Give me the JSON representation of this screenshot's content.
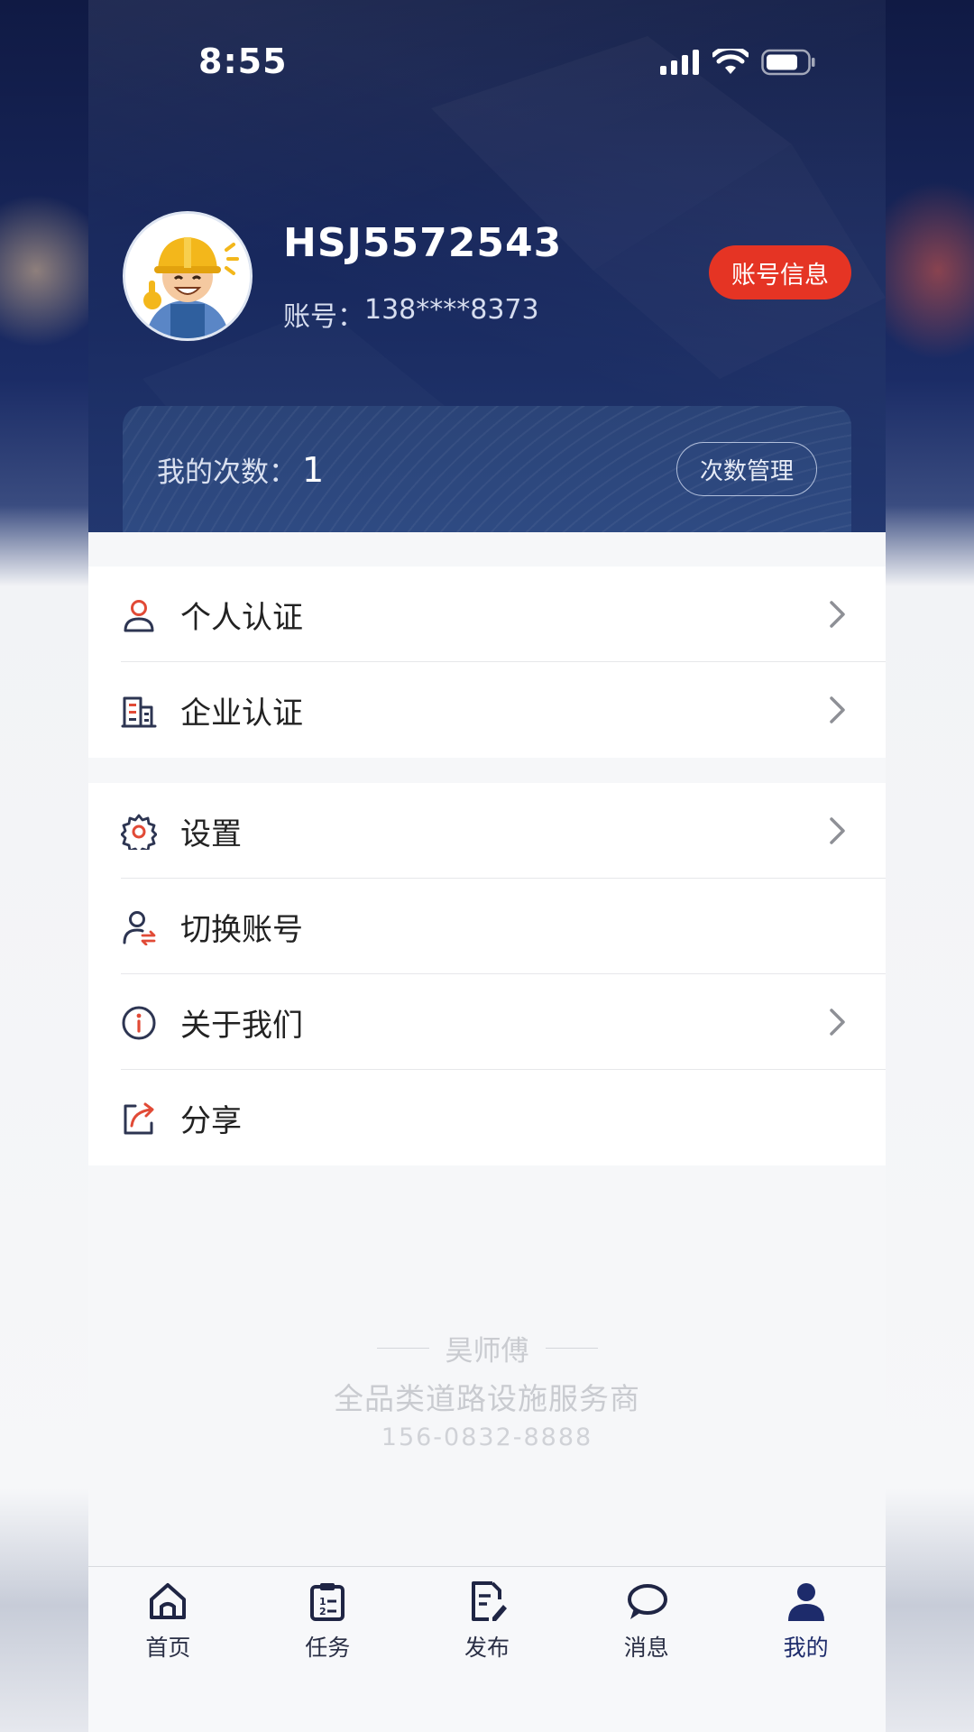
{
  "status_bar": {
    "time": "8:55"
  },
  "profile": {
    "username": "HSJ5572543",
    "account_prefix": "账号：",
    "account_number": "138****8373",
    "account_info_button": "账号信息"
  },
  "count_card": {
    "label": "我的次数：",
    "value": "1",
    "manage_button": "次数管理"
  },
  "menu_group_1": [
    {
      "label": "个人认证",
      "icon": "person-icon",
      "chevron": true
    },
    {
      "label": "企业认证",
      "icon": "building-icon",
      "chevron": true
    }
  ],
  "menu_group_2": [
    {
      "label": "设置",
      "icon": "gear-icon",
      "chevron": true
    },
    {
      "label": "切换账号",
      "icon": "switch-account-icon",
      "chevron": false
    },
    {
      "label": "关于我们",
      "icon": "info-icon",
      "chevron": true
    },
    {
      "label": "分享",
      "icon": "share-icon",
      "chevron": false
    }
  ],
  "footer": {
    "brand": "昊师傅",
    "slogan": "全品类道路设施服务商",
    "phone": "156-0832-8888"
  },
  "tabs": [
    {
      "label": "首页",
      "icon": "home-icon"
    },
    {
      "label": "任务",
      "icon": "clipboard-icon"
    },
    {
      "label": "发布",
      "icon": "edit-document-icon"
    },
    {
      "label": "消息",
      "icon": "chat-bubble-icon"
    },
    {
      "label": "我的",
      "icon": "user-icon",
      "active": true
    }
  ],
  "colors": {
    "header_dark": "#0f1a45",
    "accent_red": "#e53424",
    "icon_red": "#e14a36",
    "icon_navy": "#2d3552",
    "tab_active": "#1d2b6b"
  }
}
